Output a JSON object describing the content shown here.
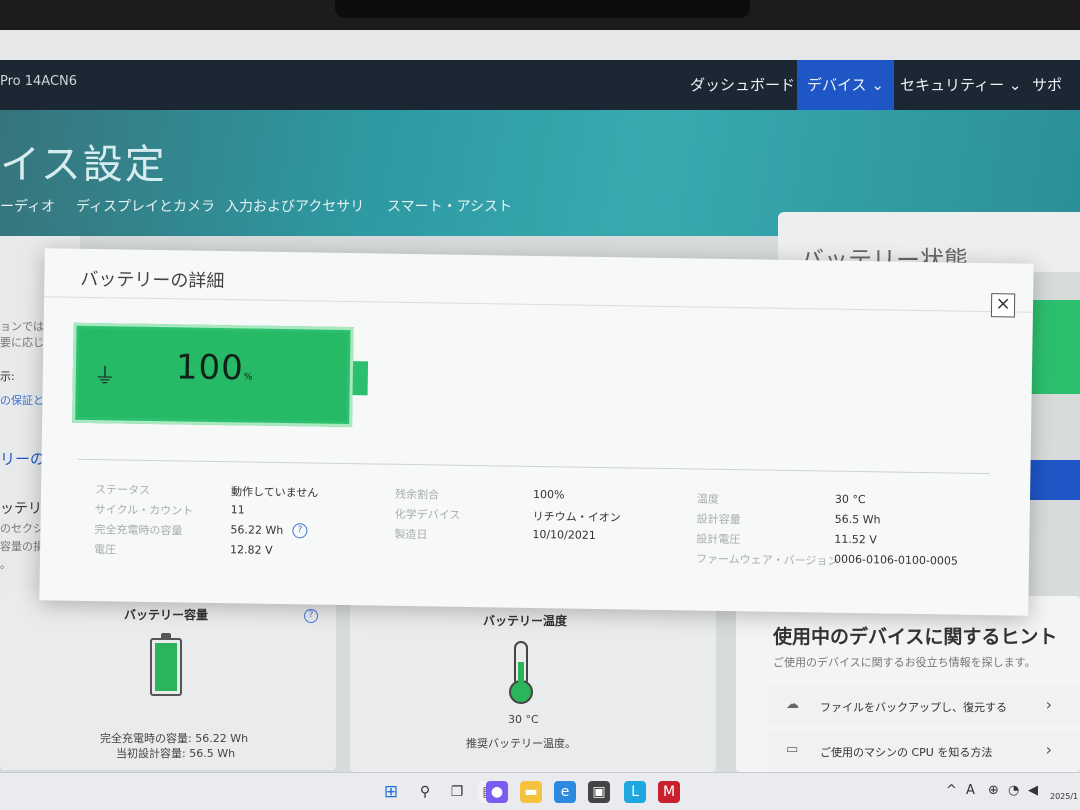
{
  "window": {
    "model": "Pro 14ACN6"
  },
  "nav": {
    "dashboard": "ダッシュボード",
    "devices": "デバイス",
    "security": "セキュリティー",
    "support": "サポート"
  },
  "hero": {
    "title": "イス設定",
    "tabs": [
      "ーディオ",
      "ディスプレイとカメラ",
      "入力およびアクセサリ",
      "スマート・アシスト"
    ]
  },
  "left_fragments": [
    "ョンでは、",
    "要に応じ",
    "示:",
    "の保証と",
    "リーの保",
    "ッテリー状",
    "のセクションで",
    "容量の損失は",
    "。"
  ],
  "side_card": {
    "title": "バッテリー状態"
  },
  "modal": {
    "title": "バッテリーの詳細",
    "close_label": "×",
    "battery": {
      "level": 100,
      "level_text": "100",
      "unit": "%",
      "plug_icon": "plug-icon"
    },
    "details": {
      "col1": [
        {
          "label": "ステータス",
          "value": "動作していません"
        },
        {
          "label": "サイクル・カウント",
          "value": "11"
        },
        {
          "label": "完全充電時の容量",
          "value": "56.22 Wh"
        },
        {
          "label": "電圧",
          "value": "12.82 V"
        }
      ],
      "col2": [
        {
          "label": "残余割合",
          "value": "100%"
        },
        {
          "label": "化学デバイス",
          "value": "リチウム・イオン"
        },
        {
          "label": "製造日",
          "value": "10/10/2021"
        }
      ],
      "col3": [
        {
          "label": "温度",
          "value": "30 °C"
        },
        {
          "label": "設計容量",
          "value": "56.5 Wh"
        },
        {
          "label": "設計電圧",
          "value": "11.52 V"
        },
        {
          "label": "ファームウェア・バージョン",
          "value": "0006-0106-0100-0005"
        }
      ]
    },
    "help_label": "?"
  },
  "cards": {
    "capacity": {
      "title": "バッテリー容量",
      "line1": "完全充電時の容量: 56.22 Wh",
      "line2": "当初設計容量: 56.5 Wh"
    },
    "temperature": {
      "title": "バッテリー温度",
      "value": "30 °C",
      "note": "推奨バッテリー温度。"
    }
  },
  "hints": {
    "title": "使用中のデバイスに関するヒント",
    "subtitle": "ご使用のデバイスに関するお役立ち情報を探します。",
    "items": [
      {
        "label": "ファイルをバックアップし、復元する",
        "icon": "cloud-upload-icon"
      },
      {
        "label": "ご使用のマシンの CPU を知る方法",
        "icon": "monitor-icon"
      }
    ]
  },
  "taskbar": {
    "date": "2025/1",
    "ime": "A",
    "chevron": "^"
  },
  "colors": {
    "nav_bg": "#1b2733",
    "nav_active": "#1e56c6",
    "battery_green": "#2cc06e",
    "hero": "#2e9aa3"
  }
}
